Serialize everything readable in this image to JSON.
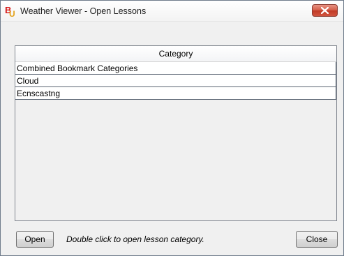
{
  "window": {
    "title": "Weather Viewer - Open Lessons",
    "app_icon": "bu-logo-icon",
    "close_icon": "close-icon"
  },
  "list": {
    "header": "Category",
    "items": [
      "Combined Bookmark Categories",
      "Cloud",
      "Ecnscastng"
    ]
  },
  "footer": {
    "open_label": "Open",
    "hint": "Double click to open lesson category.",
    "close_label": "Close"
  },
  "colors": {
    "close_button": "#c8432e",
    "dialog_bg": "#f0f0f0",
    "row_border": "#5a6472"
  }
}
